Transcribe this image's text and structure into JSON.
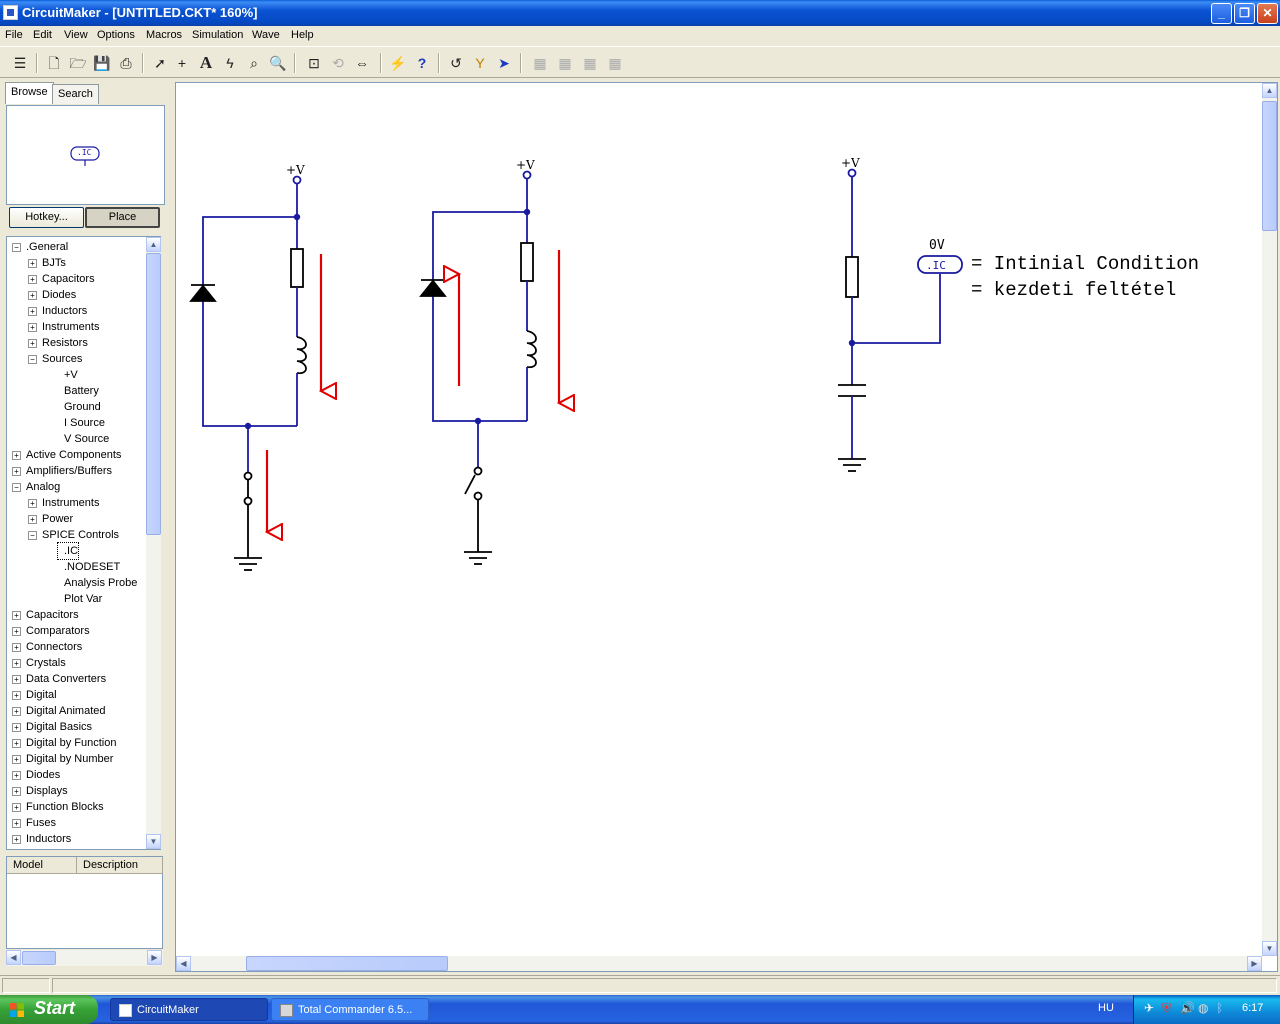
{
  "window": {
    "title": "CircuitMaker - [UNTITLED.CKT* 160%]"
  },
  "menu": [
    "File",
    "Edit",
    "View",
    "Options",
    "Macros",
    "Simulation",
    "Wave",
    "Help"
  ],
  "tabs": {
    "browse": "Browse",
    "search": "Search"
  },
  "preview": {
    "symbol": ".IC"
  },
  "buttons": {
    "hotkey": "Hotkey...",
    "place": "Place"
  },
  "tree": [
    {
      "label": ".General",
      "level": 0,
      "exp": "-"
    },
    {
      "label": "BJTs",
      "level": 1,
      "exp": "+"
    },
    {
      "label": "Capacitors",
      "level": 1,
      "exp": "+"
    },
    {
      "label": "Diodes",
      "level": 1,
      "exp": "+"
    },
    {
      "label": "Inductors",
      "level": 1,
      "exp": "+"
    },
    {
      "label": "Instruments",
      "level": 1,
      "exp": "+"
    },
    {
      "label": "Resistors",
      "level": 1,
      "exp": "+"
    },
    {
      "label": "Sources",
      "level": 1,
      "exp": "-"
    },
    {
      "label": "+V",
      "level": 2,
      "exp": ""
    },
    {
      "label": "Battery",
      "level": 2,
      "exp": ""
    },
    {
      "label": "Ground",
      "level": 2,
      "exp": ""
    },
    {
      "label": "I Source",
      "level": 2,
      "exp": ""
    },
    {
      "label": "V Source",
      "level": 2,
      "exp": ""
    },
    {
      "label": "Active Components",
      "level": 0,
      "exp": "+"
    },
    {
      "label": "Amplifiers/Buffers",
      "level": 0,
      "exp": "+"
    },
    {
      "label": "Analog",
      "level": 0,
      "exp": "-"
    },
    {
      "label": "Instruments",
      "level": 1,
      "exp": "+"
    },
    {
      "label": "Power",
      "level": 1,
      "exp": "+"
    },
    {
      "label": "SPICE Controls",
      "level": 1,
      "exp": "-"
    },
    {
      "label": ".IC",
      "level": 2,
      "exp": "",
      "selected": true
    },
    {
      "label": ".NODESET",
      "level": 2,
      "exp": ""
    },
    {
      "label": "Analysis Probe",
      "level": 2,
      "exp": ""
    },
    {
      "label": "Plot Var",
      "level": 2,
      "exp": ""
    },
    {
      "label": "Capacitors",
      "level": 0,
      "exp": "+"
    },
    {
      "label": "Comparators",
      "level": 0,
      "exp": "+"
    },
    {
      "label": "Connectors",
      "level": 0,
      "exp": "+"
    },
    {
      "label": "Crystals",
      "level": 0,
      "exp": "+"
    },
    {
      "label": "Data Converters",
      "level": 0,
      "exp": "+"
    },
    {
      "label": "Digital",
      "level": 0,
      "exp": "+"
    },
    {
      "label": "Digital Animated",
      "level": 0,
      "exp": "+"
    },
    {
      "label": "Digital Basics",
      "level": 0,
      "exp": "+"
    },
    {
      "label": "Digital by Function",
      "level": 0,
      "exp": "+"
    },
    {
      "label": "Digital by Number",
      "level": 0,
      "exp": "+"
    },
    {
      "label": "Diodes",
      "level": 0,
      "exp": "+"
    },
    {
      "label": "Displays",
      "level": 0,
      "exp": "+"
    },
    {
      "label": "Function Blocks",
      "level": 0,
      "exp": "+"
    },
    {
      "label": "Fuses",
      "level": 0,
      "exp": "+"
    },
    {
      "label": "Inductors",
      "level": 0,
      "exp": "+"
    }
  ],
  "model_table": {
    "col_model": "Model",
    "col_description": "Description"
  },
  "schematic": {
    "supply_label": "+V",
    "ic_value": "0V",
    "ic_symbol": ".IC",
    "note_line1": "= Intinial Condition",
    "note_line2": "= kezdeti feltétel"
  },
  "colors": {
    "wire": "#1a1aa0",
    "arrow": "#e00000",
    "junction": "#1a1aa0"
  },
  "taskbar": {
    "start": "Start",
    "tasks": [
      "CircuitMaker",
      "Total Commander 6.5..."
    ],
    "lang": "HU",
    "clock": "6:17"
  }
}
